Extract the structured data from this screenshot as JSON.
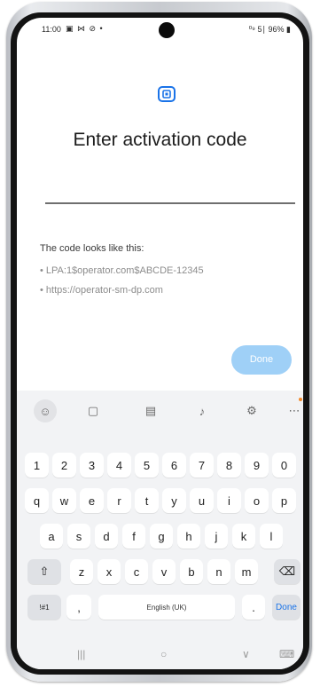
{
  "status_bar": {
    "time": "11:00",
    "left_icons": "▣ ⋈ ⊘ •",
    "right_status": "⁰⁹ 5∣ 96% ▮"
  },
  "screen": {
    "icon": "sim-card-icon",
    "title": "Enter activation code",
    "input_value": "",
    "hint_text": "The code looks like this:",
    "examples": [
      "• LPA:1$operator.com$ABCDE-12345",
      "• https://operator-sm-dp.com"
    ],
    "done_button": "Done"
  },
  "keyboard": {
    "toolbar": [
      "emoji-icon",
      "clipboard-icon",
      "notes-icon",
      "microphone-icon",
      "settings-icon",
      "more-icon"
    ],
    "rows": {
      "numbers": [
        "1",
        "2",
        "3",
        "4",
        "5",
        "6",
        "7",
        "8",
        "9",
        "0"
      ],
      "row1": [
        "q",
        "w",
        "e",
        "r",
        "t",
        "y",
        "u",
        "i",
        "o",
        "p"
      ],
      "row2": [
        "a",
        "s",
        "d",
        "f",
        "g",
        "h",
        "j",
        "k",
        "l"
      ],
      "row3": [
        "z",
        "x",
        "c",
        "v",
        "b",
        "n",
        "m"
      ]
    },
    "symbols_key": "!#1",
    "comma_key": ",",
    "space_label": "English (UK)",
    "period_key": ".",
    "done_key": "Done",
    "shift_symbol": "⇧",
    "backspace_symbol": "⌫"
  },
  "nav_bar": {
    "recents": "|||",
    "home": "○",
    "back": "∨",
    "keyboard": "⌨"
  }
}
